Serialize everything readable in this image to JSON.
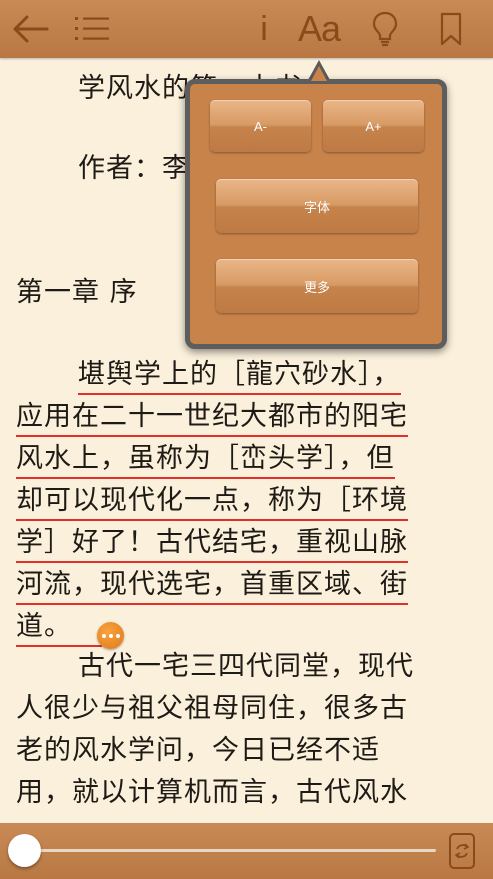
{
  "toolbar": {
    "font_label": "Aa",
    "info_label": "i"
  },
  "content": {
    "lines": [
      "学风水的第一本书",
      "作者：李",
      "第一章 序",
      "堪舆学上的［龍穴砂水］，",
      "应用在二十一世纪大都市的阳宅",
      "风水上，虽称为［峦头学］，但",
      "却可以现代化一点，称为［环境",
      "学］好了！古代结宅，重视山脉",
      "河流，现代选宅，首重区域、街",
      "道。",
      "古代一宅三四代同堂，现代",
      "人很少与祖父祖母同住，很多古",
      "老的风水学问，今日已经不适",
      "用，就以计算机而言，古代风水"
    ]
  },
  "popover": {
    "decrease_label": "A-",
    "increase_label": "A+",
    "font_label": "字体",
    "more_label": "更多"
  },
  "reading_progress": 0,
  "colors": {
    "bar": "#c0804b",
    "page": "#fbf0dc",
    "underline": "#e0302a",
    "icon": "#8a4a1c"
  }
}
